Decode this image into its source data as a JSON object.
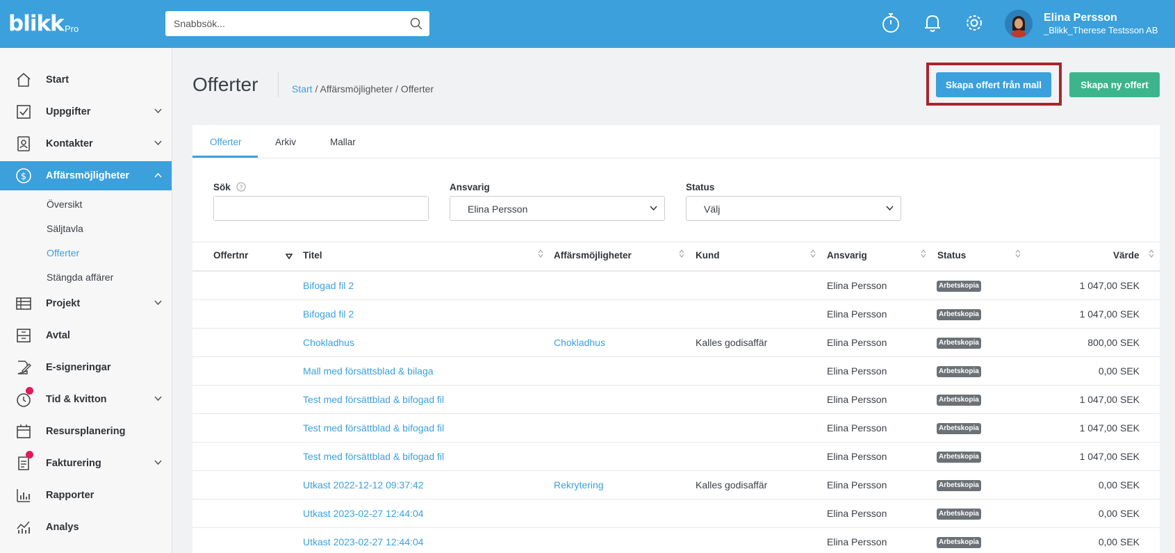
{
  "app": {
    "logo_text": "blikk",
    "logo_sub": "Pro",
    "search_placeholder": "Snabbsök...",
    "user_name": "Elina Persson",
    "user_company": "_Blikk_Therese Testsson AB"
  },
  "sidebar": {
    "items": [
      {
        "label": "Start",
        "icon": "home-icon"
      },
      {
        "label": "Uppgifter",
        "icon": "checkbox-icon"
      },
      {
        "label": "Kontakter",
        "icon": "contacts-icon"
      },
      {
        "label": "Affärsmöjligheter",
        "icon": "dollar-circle-icon"
      },
      {
        "label": "Projekt",
        "icon": "table-icon"
      },
      {
        "label": "Avtal",
        "icon": "archive-icon"
      },
      {
        "label": "E-signeringar",
        "icon": "signature-icon"
      },
      {
        "label": "Tid & kvitton",
        "icon": "clock-icon"
      },
      {
        "label": "Resursplanering",
        "icon": "calendar-icon"
      },
      {
        "label": "Fakturering",
        "icon": "invoice-icon"
      },
      {
        "label": "Rapporter",
        "icon": "bar-chart-icon"
      },
      {
        "label": "Analys",
        "icon": "analytics-icon"
      }
    ],
    "subitems": [
      "Översikt",
      "Säljtavla",
      "Offerter",
      "Stängda affärer"
    ]
  },
  "header": {
    "title": "Offerter",
    "breadcrumb_start": "Start",
    "breadcrumb_rest": " / Affärsmöjligheter / Offerter",
    "btn_template": "Skapa offert från mall",
    "btn_new": "Skapa ny offert"
  },
  "tabs": [
    "Offerter",
    "Arkiv",
    "Mallar"
  ],
  "filters": {
    "search_label": "Sök",
    "search_value": "",
    "responsible_label": "Ansvarig",
    "responsible_value": "Elina Persson",
    "status_label": "Status",
    "status_value": "Välj"
  },
  "table": {
    "headers": [
      "Offertnr",
      "Titel",
      "Affärsmöjligheter",
      "Kund",
      "Ansvarig",
      "Status",
      "Värde"
    ],
    "rows": [
      {
        "nr": "",
        "title": "Bifogad fil 2",
        "deal": "",
        "customer": "",
        "responsible": "Elina Persson",
        "status": "Arbetskopia",
        "value": "1 047,00 SEK"
      },
      {
        "nr": "",
        "title": "Bifogad fil 2",
        "deal": "",
        "customer": "",
        "responsible": "Elina Persson",
        "status": "Arbetskopia",
        "value": "1 047,00 SEK"
      },
      {
        "nr": "",
        "title": "Chokladhus",
        "deal": "Chokladhus",
        "customer": "Kalles godisaffär",
        "responsible": "Elina Persson",
        "status": "Arbetskopia",
        "value": "800,00 SEK"
      },
      {
        "nr": "",
        "title": "Mall med försättsblad & bilaga",
        "deal": "",
        "customer": "",
        "responsible": "Elina Persson",
        "status": "Arbetskopia",
        "value": "0,00 SEK"
      },
      {
        "nr": "",
        "title": "Test med försättblad & bifogad fil",
        "deal": "",
        "customer": "",
        "responsible": "Elina Persson",
        "status": "Arbetskopia",
        "value": "1 047,00 SEK"
      },
      {
        "nr": "",
        "title": "Test med försättblad & bifogad fil",
        "deal": "",
        "customer": "",
        "responsible": "Elina Persson",
        "status": "Arbetskopia",
        "value": "1 047,00 SEK"
      },
      {
        "nr": "",
        "title": "Test med försättblad & bifogad fil",
        "deal": "",
        "customer": "",
        "responsible": "Elina Persson",
        "status": "Arbetskopia",
        "value": "1 047,00 SEK"
      },
      {
        "nr": "",
        "title": "Utkast 2022-12-12 09:37:42",
        "deal": "Rekrytering",
        "customer": "Kalles godisaffär",
        "responsible": "Elina Persson",
        "status": "Arbetskopia",
        "value": "0,00 SEK"
      },
      {
        "nr": "",
        "title": "Utkast 2023-02-27 12:44:04",
        "deal": "",
        "customer": "",
        "responsible": "Elina Persson",
        "status": "Arbetskopia",
        "value": "0,00 SEK"
      },
      {
        "nr": "",
        "title": "Utkast 2023-02-27 12:44:04",
        "deal": "",
        "customer": "",
        "responsible": "Elina Persson",
        "status": "Arbetskopia",
        "value": "0,00 SEK"
      }
    ]
  },
  "colors": {
    "brand_blue": "#3ba0dc",
    "green": "#3db58c",
    "highlight_red": "#a8262a",
    "badge_gray": "#6c7176",
    "notification_red": "#e5185c"
  }
}
